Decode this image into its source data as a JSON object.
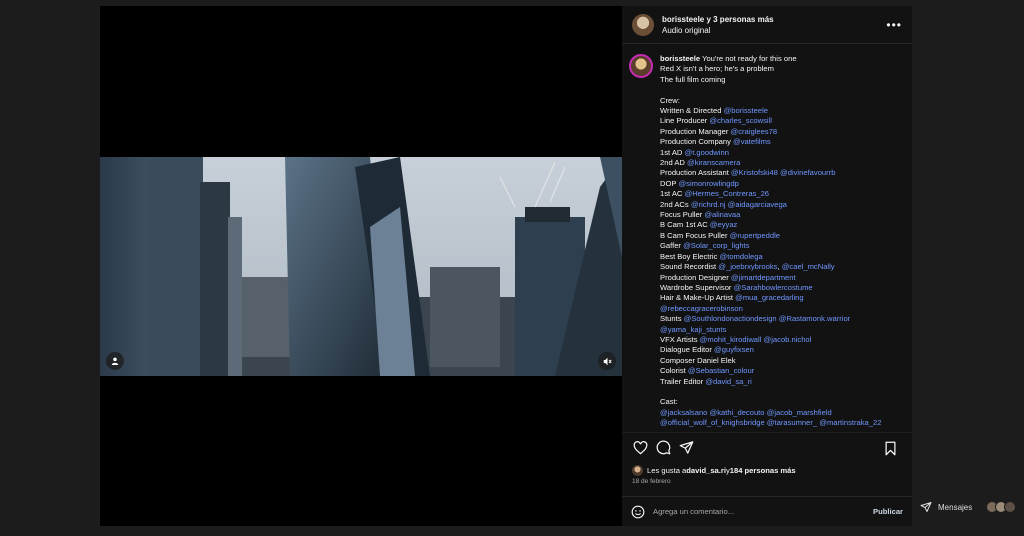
{
  "post": {
    "header": {
      "usernames": "borissteele y 3 personas más",
      "audio": "Audio original"
    },
    "caption": {
      "lines": [
        {
          "segments": [
            {
              "t": "borissteele",
              "type": "user"
            },
            {
              "t": " You're not ready for this one",
              "type": "text"
            }
          ]
        },
        {
          "segments": [
            {
              "t": "Red X isn't a hero; he's a problem",
              "type": "text"
            }
          ]
        },
        {
          "segments": [
            {
              "t": "The full film coming",
              "type": "text"
            }
          ]
        },
        {
          "segments": []
        },
        {
          "segments": [
            {
              "t": "Crew:",
              "type": "text"
            }
          ]
        },
        {
          "segments": [
            {
              "t": "Written & Directed ",
              "type": "text"
            },
            {
              "t": "@borissteele",
              "type": "mention"
            }
          ]
        },
        {
          "segments": [
            {
              "t": "Line Producer ",
              "type": "text"
            },
            {
              "t": "@charles_scowsill",
              "type": "mention"
            }
          ]
        },
        {
          "segments": [
            {
              "t": "Production Manager ",
              "type": "text"
            },
            {
              "t": "@craiglees78",
              "type": "mention"
            }
          ]
        },
        {
          "segments": [
            {
              "t": "Production Company ",
              "type": "text"
            },
            {
              "t": "@vatefilms",
              "type": "mention"
            }
          ]
        },
        {
          "segments": [
            {
              "t": "1st AD ",
              "type": "text"
            },
            {
              "t": "@t.goodwinn",
              "type": "mention"
            }
          ]
        },
        {
          "segments": [
            {
              "t": "2nd AD ",
              "type": "text"
            },
            {
              "t": "@kiranscamera",
              "type": "mention"
            }
          ]
        },
        {
          "segments": [
            {
              "t": "Production Assistant ",
              "type": "text"
            },
            {
              "t": "@Kristofski48",
              "type": "mention"
            },
            {
              "t": " ",
              "type": "text"
            },
            {
              "t": "@divinefavourrb",
              "type": "mention"
            }
          ]
        },
        {
          "segments": [
            {
              "t": "DOP ",
              "type": "text"
            },
            {
              "t": "@simonrowlingdp",
              "type": "mention"
            }
          ]
        },
        {
          "segments": [
            {
              "t": "1st AC ",
              "type": "text"
            },
            {
              "t": "@Hermes_Contreras_26",
              "type": "mention"
            }
          ]
        },
        {
          "segments": [
            {
              "t": "2nd ACs ",
              "type": "text"
            },
            {
              "t": "@richrd.nj",
              "type": "mention"
            },
            {
              "t": " ",
              "type": "text"
            },
            {
              "t": "@aidagarciavega",
              "type": "mention"
            }
          ]
        },
        {
          "segments": [
            {
              "t": "Focus Puller ",
              "type": "text"
            },
            {
              "t": "@alinavaa",
              "type": "mention"
            }
          ]
        },
        {
          "segments": [
            {
              "t": "B Cam 1st AC ",
              "type": "text"
            },
            {
              "t": "@eyyaz",
              "type": "mention"
            }
          ]
        },
        {
          "segments": [
            {
              "t": "B Cam Focus Puller ",
              "type": "text"
            },
            {
              "t": "@rupertpeddle",
              "type": "mention"
            }
          ]
        },
        {
          "segments": [
            {
              "t": "Gaffer ",
              "type": "text"
            },
            {
              "t": "@Solar_corp_lights",
              "type": "mention"
            }
          ]
        },
        {
          "segments": [
            {
              "t": "Best Boy Electric ",
              "type": "text"
            },
            {
              "t": "@tomdolega",
              "type": "mention"
            }
          ]
        },
        {
          "segments": [
            {
              "t": "Sound Recordist ",
              "type": "text"
            },
            {
              "t": "@_joebrxybrooks",
              "type": "mention"
            },
            {
              "t": ", ",
              "type": "text"
            },
            {
              "t": "@cael_mcNally",
              "type": "mention"
            }
          ]
        },
        {
          "segments": [
            {
              "t": "Production Designer ",
              "type": "text"
            },
            {
              "t": "@jimartdepartment",
              "type": "mention"
            }
          ]
        },
        {
          "segments": [
            {
              "t": "Wardrobe Supervisor ",
              "type": "text"
            },
            {
              "t": "@Sarahbowlercostume",
              "type": "mention"
            }
          ]
        },
        {
          "segments": [
            {
              "t": "Hair & Make-Up Artist ",
              "type": "text"
            },
            {
              "t": "@mua_gracedarling",
              "type": "mention"
            }
          ]
        },
        {
          "segments": [
            {
              "t": "@rebeccagracerobinson",
              "type": "mention"
            }
          ]
        },
        {
          "segments": [
            {
              "t": "Stunts ",
              "type": "text"
            },
            {
              "t": "@Southlondonactiondesign",
              "type": "mention"
            },
            {
              "t": " ",
              "type": "text"
            },
            {
              "t": "@Rastamonk.warrior",
              "type": "mention"
            }
          ]
        },
        {
          "segments": [
            {
              "t": "@yama_kaji_stunts",
              "type": "mention"
            }
          ]
        },
        {
          "segments": [
            {
              "t": "VFX Artists ",
              "type": "text"
            },
            {
              "t": "@mohit_kirodiwall",
              "type": "mention"
            },
            {
              "t": " ",
              "type": "text"
            },
            {
              "t": "@jacob.nichol",
              "type": "mention"
            }
          ]
        },
        {
          "segments": [
            {
              "t": "Dialogue Editor ",
              "type": "text"
            },
            {
              "t": "@guyfixsen",
              "type": "mention"
            }
          ]
        },
        {
          "segments": [
            {
              "t": "Composer Daniel Elek",
              "type": "text"
            }
          ]
        },
        {
          "segments": [
            {
              "t": "Colorist ",
              "type": "text"
            },
            {
              "t": "@Sebastian_colour",
              "type": "mention"
            }
          ]
        },
        {
          "segments": [
            {
              "t": "Trailer Editor ",
              "type": "text"
            },
            {
              "t": "@david_sa_ri",
              "type": "mention"
            }
          ]
        },
        {
          "segments": []
        },
        {
          "segments": [
            {
              "t": "Cast:",
              "type": "text"
            }
          ]
        },
        {
          "segments": [
            {
              "t": "@jacksalsano",
              "type": "mention"
            },
            {
              "t": " ",
              "type": "text"
            },
            {
              "t": "@kathi_decouto",
              "type": "mention"
            },
            {
              "t": " ",
              "type": "text"
            },
            {
              "t": "@jacob_marshfield",
              "type": "mention"
            }
          ]
        },
        {
          "segments": [
            {
              "t": "@official_wolf_of_knighsbridge",
              "type": "mention"
            },
            {
              "t": " ",
              "type": "text"
            },
            {
              "t": "@tarasumner_",
              "type": "mention"
            },
            {
              "t": " ",
              "type": "text"
            },
            {
              "t": "@martinstraka_22",
              "type": "mention"
            }
          ]
        }
      ]
    },
    "likes": {
      "prefix": "Les gusta a ",
      "user": "david_sa.ri",
      "suffix": " y ",
      "count": "184 personas más"
    },
    "date": "18 de febrero",
    "comment": {
      "placeholder": "Agrega un comentario...",
      "post_label": "Publicar"
    }
  },
  "messages": {
    "label": "Mensajes"
  },
  "colors": {
    "mention": "#6f97ff",
    "panel_bg": "#121212",
    "backdrop": "#1c1c1c"
  },
  "icons": [
    "more-icon",
    "user-tag-icon",
    "mute-icon",
    "heart-icon",
    "comment-icon",
    "share-icon",
    "bookmark-icon",
    "emoji-icon"
  ]
}
